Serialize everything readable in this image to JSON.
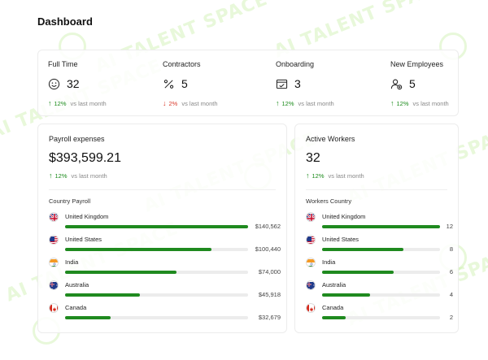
{
  "page": {
    "title": "Dashboard"
  },
  "watermark": {
    "text": "AI TALENT SPACE"
  },
  "colors": {
    "up": "#1a8a1a",
    "down": "#d93a2b",
    "bar": "#1f8a1f",
    "track": "#ececec"
  },
  "stats": [
    {
      "label": "Full Time",
      "value": "32",
      "icon": "smile-icon",
      "trend_dir": "up",
      "trend_arrow": "↑",
      "trend_pct": "12%",
      "trend_text": "vs last month"
    },
    {
      "label": "Contractors",
      "value": "5",
      "icon": "percent-icon",
      "trend_dir": "down",
      "trend_arrow": "↓",
      "trend_pct": "2%",
      "trend_text": "vs last month"
    },
    {
      "label": "Onboarding",
      "value": "3",
      "icon": "window-icon",
      "trend_dir": "up",
      "trend_arrow": "↑",
      "trend_pct": "12%",
      "trend_text": "vs last month"
    },
    {
      "label": "New Employees",
      "value": "5",
      "icon": "user-add-icon",
      "trend_dir": "up",
      "trend_arrow": "↑",
      "trend_pct": "12%",
      "trend_text": "vs last month"
    }
  ],
  "payroll": {
    "title": "Payroll expenses",
    "value": "$393,599.21",
    "trend_arrow": "↑",
    "trend_pct": "12%",
    "trend_text": "vs last month",
    "section_label": "Country Payroll",
    "rows": [
      {
        "country": "United Kingdom",
        "flag": "uk-flag-icon",
        "value": "$140,562",
        "fraction": 1.0
      },
      {
        "country": "United States",
        "flag": "us-flag-icon",
        "value": "$100,440",
        "fraction": 0.8
      },
      {
        "country": "India",
        "flag": "india-flag-icon",
        "value": "$74,000",
        "fraction": 0.61
      },
      {
        "country": "Australia",
        "flag": "australia-flag-icon",
        "value": "$45,918",
        "fraction": 0.41
      },
      {
        "country": "Canada",
        "flag": "canada-flag-icon",
        "value": "$32,679",
        "fraction": 0.25
      }
    ]
  },
  "workers": {
    "title": "Active Workers",
    "value": "32",
    "trend_arrow": "↑",
    "trend_pct": "12%",
    "trend_text": "vs last month",
    "section_label": "Workers Country",
    "rows": [
      {
        "country": "United Kingdom",
        "flag": "uk-flag-icon",
        "value": "12",
        "fraction": 1.0
      },
      {
        "country": "United States",
        "flag": "us-flag-icon",
        "value": "8",
        "fraction": 0.69
      },
      {
        "country": "India",
        "flag": "india-flag-icon",
        "value": "6",
        "fraction": 0.61
      },
      {
        "country": "Australia",
        "flag": "australia-flag-icon",
        "value": "4",
        "fraction": 0.41
      },
      {
        "country": "Canada",
        "flag": "canada-flag-icon",
        "value": "2",
        "fraction": 0.2
      }
    ]
  }
}
